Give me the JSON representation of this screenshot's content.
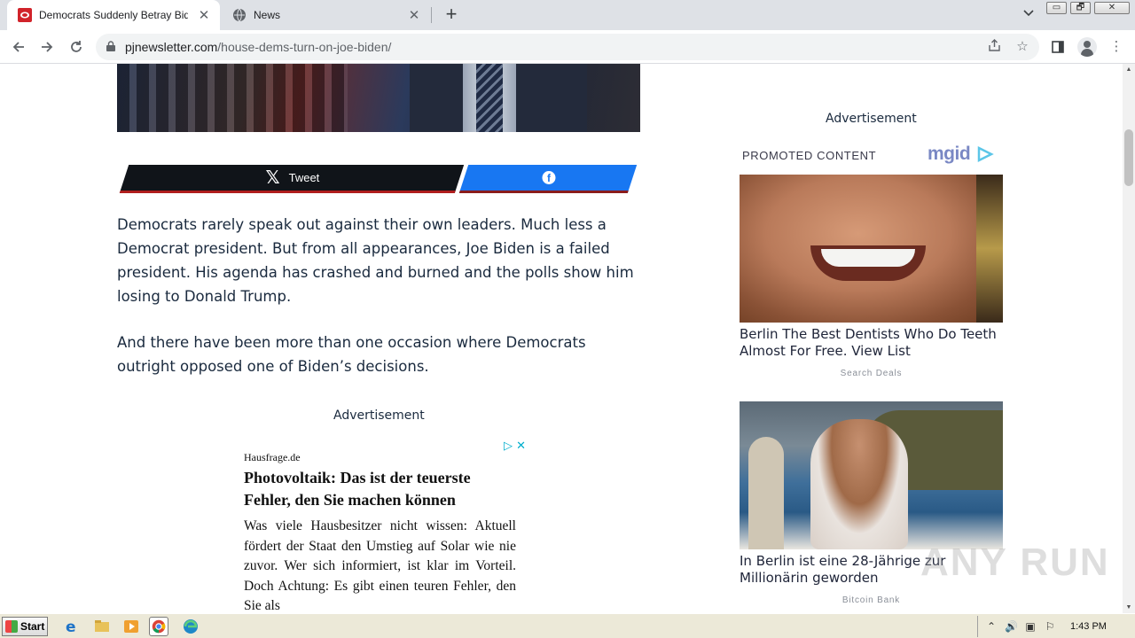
{
  "browser": {
    "tabs": [
      {
        "title": "Democrats Suddenly Betray Biden over",
        "active": true
      },
      {
        "title": "News",
        "active": false
      }
    ],
    "url_host": "pjnewsletter.com",
    "url_path": "/house-dems-turn-on-joe-biden/",
    "window_buttons": [
      "▭",
      "🗗",
      "✕"
    ]
  },
  "share": {
    "tweet_label": "Tweet"
  },
  "article": {
    "paragraphs": [
      "Democrats rarely speak out against their own leaders. Much less a Democrat president. But from all appearances, Joe Biden is a failed president. His agenda has crashed and burned and the polls show him losing to Donald Trump.",
      "And there have been more than one occasion where Democrats outright opposed one of Biden’s decisions."
    ],
    "ad_label": "Advertisement"
  },
  "inline_ad": {
    "source": "Hausfrage.de",
    "headline": "Photovoltaik: Das ist der teuerste Fehler, den Sie machen können",
    "body": "Was viele Hausbesitzer nicht wissen: Aktuell fördert der Staat den Umstieg auf Solar wie nie zuvor. Wer sich informiert, ist klar im Vorteil. Doch Achtung: Es gibt einen teuren Fehler, den Sie als"
  },
  "sidebar": {
    "ad_label": "Advertisement",
    "promoted_label": "PROMOTED CONTENT",
    "brand": "mgid",
    "cards": [
      {
        "title": "Berlin The Best Dentists Who Do Teeth Almost For Free. View List",
        "source": "Search Deals"
      },
      {
        "title": "In Berlin ist eine 28-Jährige zur Millionärin geworden",
        "source": "Bitcoin Bank"
      }
    ]
  },
  "watermark": "ANY RUN",
  "taskbar": {
    "start_label": "Start",
    "clock": "1:43 PM"
  }
}
